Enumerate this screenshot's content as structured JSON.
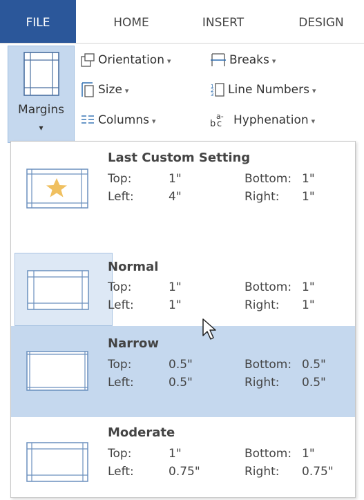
{
  "tabs": [
    {
      "label": "FILE",
      "active": true
    },
    {
      "label": "HOME"
    },
    {
      "label": "INSERT"
    },
    {
      "label": "DESIGN"
    }
  ],
  "ribbon": {
    "margins": {
      "label": "Margins",
      "caret": "▾"
    },
    "commands": [
      {
        "label": "Orientation",
        "icon": "orientation-icon"
      },
      {
        "label": "Size",
        "icon": "size-icon"
      },
      {
        "label": "Columns",
        "icon": "columns-icon"
      },
      {
        "label": "Breaks",
        "icon": "breaks-icon"
      },
      {
        "label": "Line Numbers",
        "icon": "line-numbers-icon"
      },
      {
        "label": "Hyphenation",
        "icon": "hyphenation-icon"
      }
    ],
    "dropdown_caret": "▾"
  },
  "margin_presets": [
    {
      "title": "Last Custom Setting",
      "top_label": "Top:",
      "top": "1\"",
      "bottom_label": "Bottom:",
      "bottom": "1\"",
      "left_label": "Left:",
      "left": "4\"",
      "right_label": "Right:",
      "right": "1\"",
      "icon": "custom-margins-star-icon"
    },
    {
      "title": "Normal",
      "top_label": "Top:",
      "top": "1\"",
      "bottom_label": "Bottom:",
      "bottom": "1\"",
      "left_label": "Left:",
      "left": "1\"",
      "right_label": "Right:",
      "right": "1\"",
      "state": "selected"
    },
    {
      "title": "Narrow",
      "top_label": "Top:",
      "top": "0.5\"",
      "bottom_label": "Bottom:",
      "bottom": "0.5\"",
      "left_label": "Left:",
      "left": "0.5\"",
      "right_label": "Right:",
      "right": "0.5\"",
      "state": "hover"
    },
    {
      "title": "Moderate",
      "top_label": "Top:",
      "top": "1\"",
      "bottom_label": "Bottom:",
      "bottom": "1\"",
      "left_label": "Left:",
      "left": "0.75\"",
      "right_label": "Right:",
      "right": "0.75\""
    }
  ],
  "colors": {
    "file_tab": "#2b579a",
    "hover": "#c5d8ee",
    "selected": "#dde8f5",
    "star": "#f0c060",
    "thumb_lines": "#6a8fbd"
  }
}
